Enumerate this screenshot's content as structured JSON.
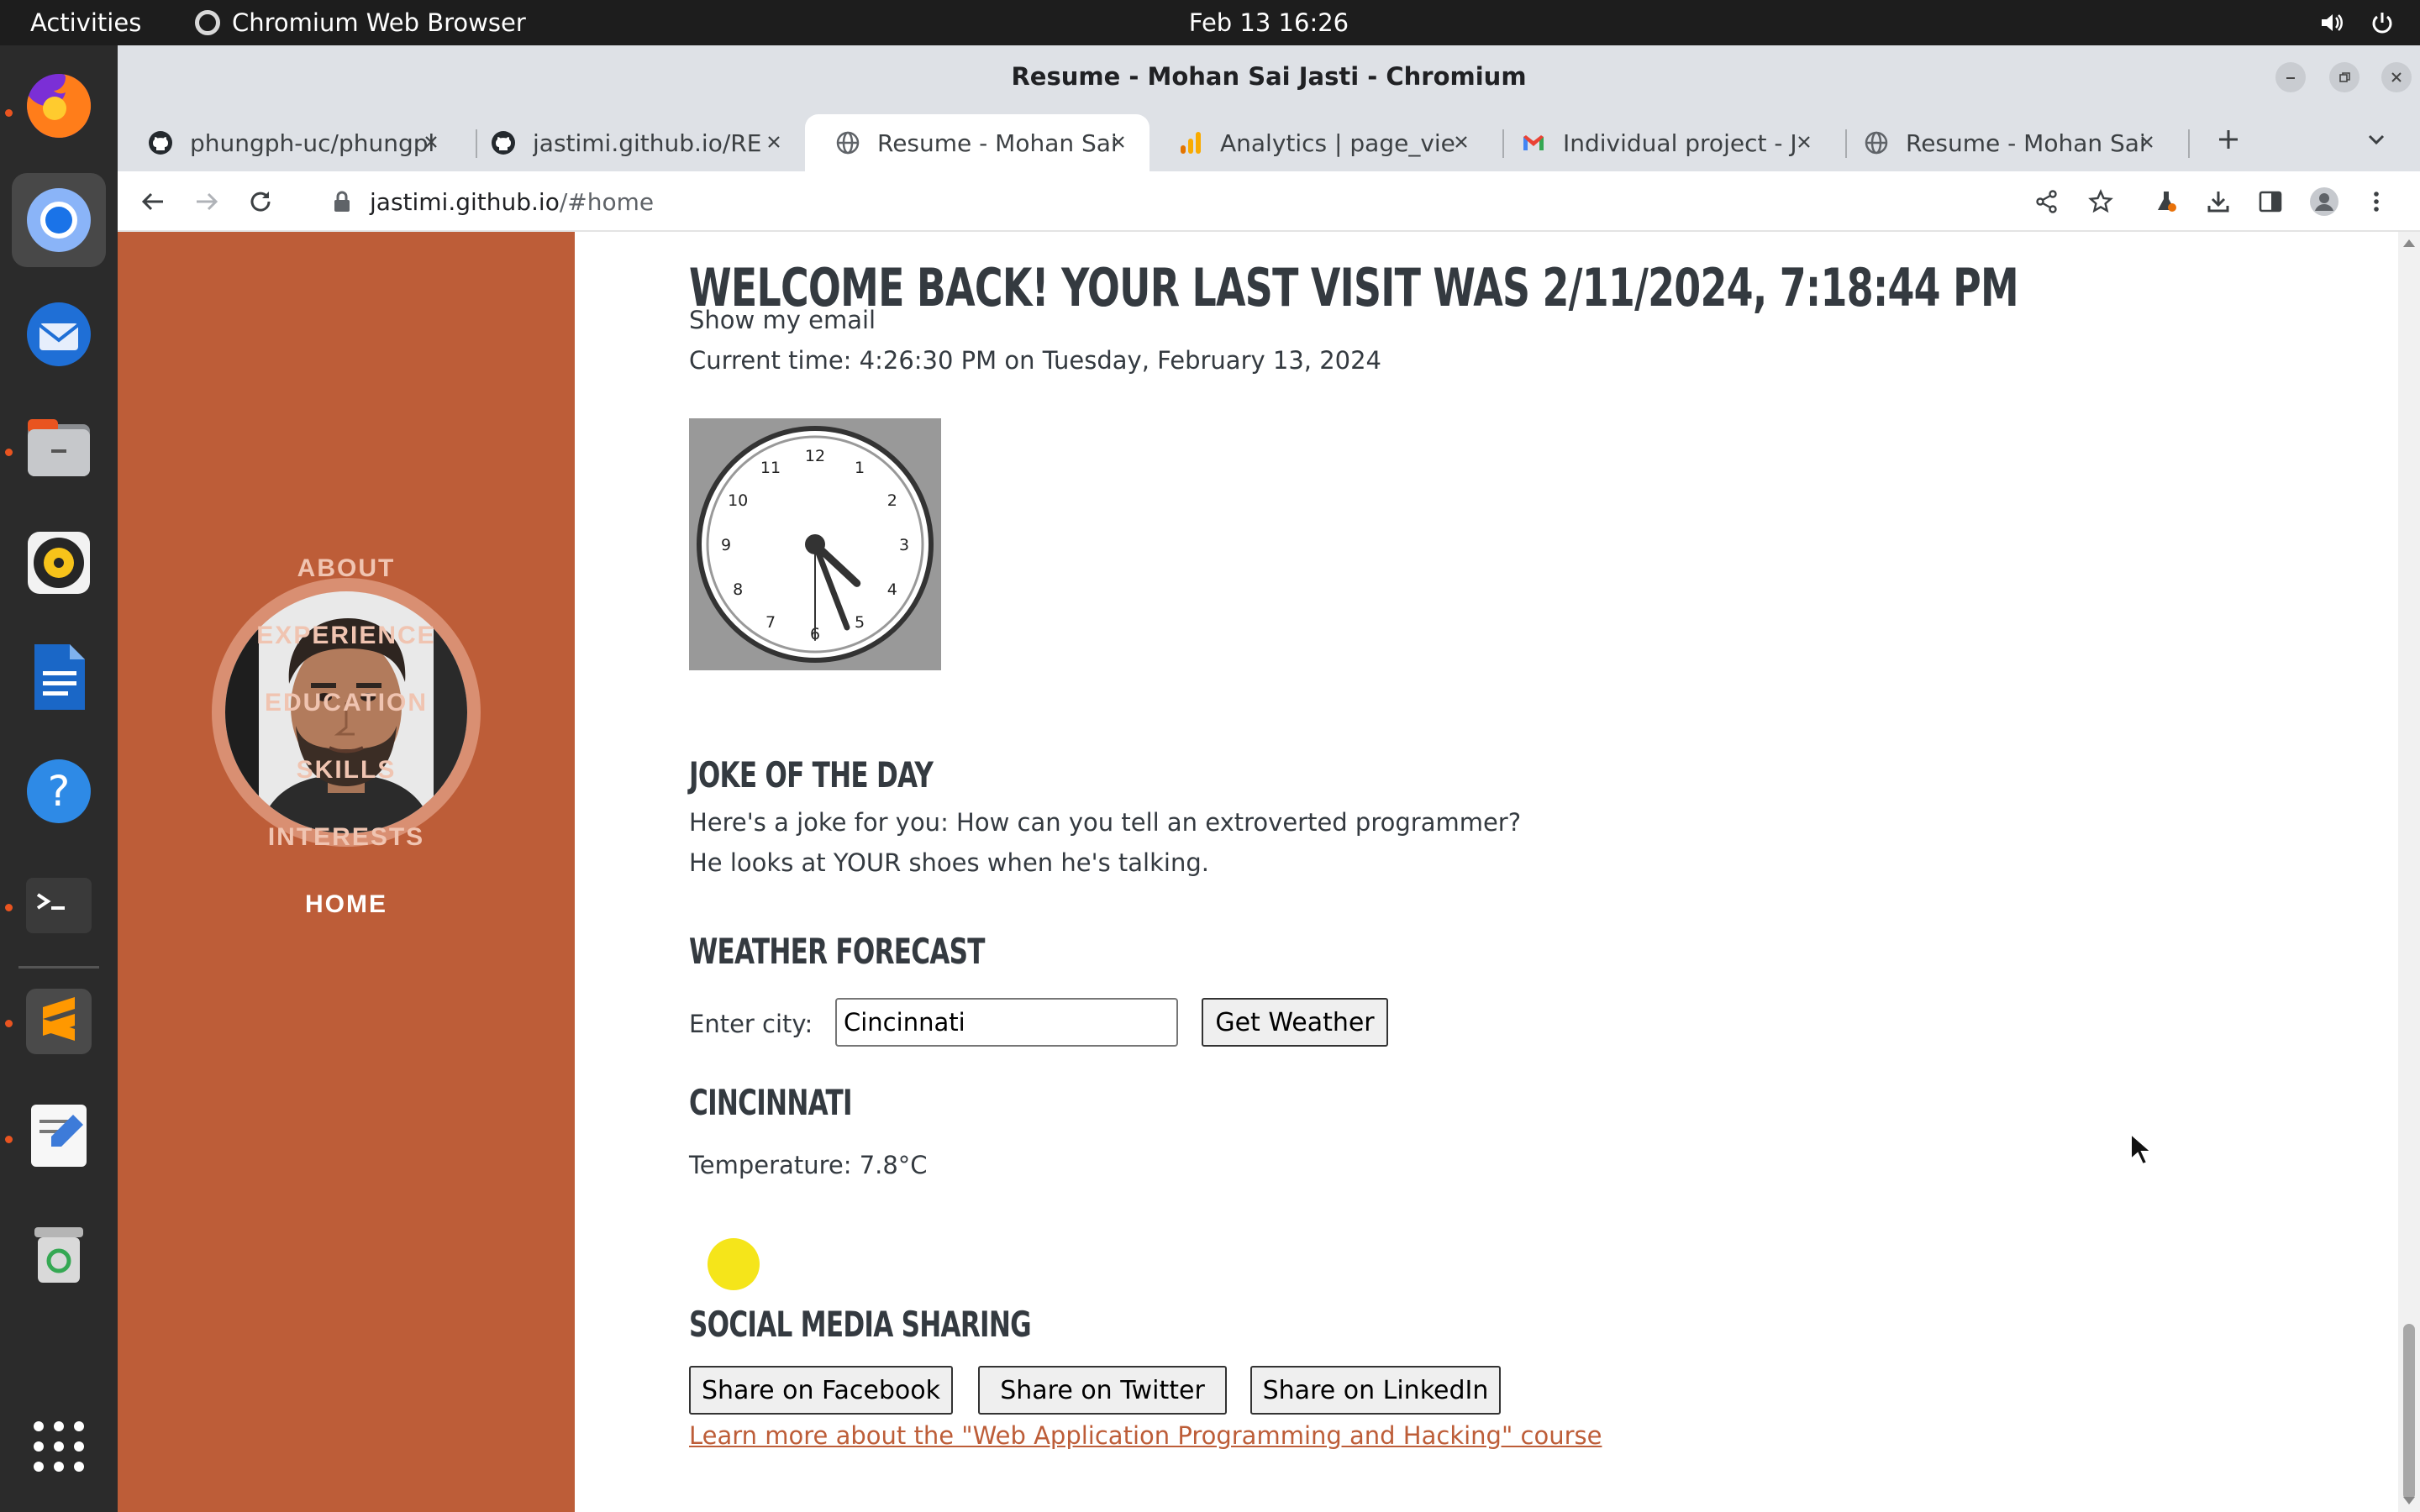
{
  "topbar": {
    "activities": "Activities",
    "app_name": "Chromium Web Browser",
    "datetime": "Feb 13  16:26"
  },
  "dock": {
    "items": [
      "firefox-icon",
      "chromium-icon",
      "thunderbird-icon",
      "files-icon",
      "rhythmbox-icon",
      "writer-icon",
      "help-icon",
      "terminal-icon",
      "sublime-icon",
      "text-editor-icon",
      "trash-icon",
      "app-grid-icon"
    ]
  },
  "window": {
    "title": "Resume - Mohan Sai Jasti - Chromium"
  },
  "tabs": [
    {
      "label": "phungph-uc/phungph",
      "icon": "github-icon"
    },
    {
      "label": "jastimi.github.io/RE",
      "icon": "github-icon"
    },
    {
      "label": "Resume - Mohan Sai",
      "icon": "globe-icon",
      "active": true
    },
    {
      "label": "Analytics | page_vie",
      "icon": "analytics-icon"
    },
    {
      "label": "Individual project - J",
      "icon": "gmail-icon"
    },
    {
      "label": "Resume - Mohan Sai",
      "icon": "globe-icon"
    }
  ],
  "toolbar": {
    "url_host": "jastimi.github.io",
    "url_path": "/#home"
  },
  "sidebar": {
    "nav": [
      "ABOUT",
      "EXPERIENCE",
      "EDUCATION",
      "SKILLS",
      "INTERESTS",
      "HOME"
    ],
    "current": "HOME"
  },
  "main": {
    "welcome": "WELCOME BACK! YOUR LAST VISIT WAS 2/11/2024, 7:18:44 PM",
    "show_email": "Show my email",
    "current_time": "Current time: 4:26:30 PM on Tuesday, February 13, 2024",
    "clock": {
      "hours": 4,
      "minutes": 26,
      "seconds": 30,
      "numbers": [
        "12",
        "1",
        "2",
        "3",
        "4",
        "5",
        "6",
        "7",
        "8",
        "9",
        "10",
        "11"
      ]
    },
    "joke_heading": "JOKE OF THE DAY",
    "joke_line1": "Here's a joke for you: How can you tell an extroverted programmer?",
    "joke_line2": "He looks at YOUR shoes when he's talking.",
    "weather_heading": "WEATHER FORECAST",
    "city_label": "Enter city:",
    "city_value": "Cincinnati",
    "get_weather": "Get Weather",
    "city_heading": "CINCINNATI",
    "temperature": "Temperature: 7.8°C",
    "social_heading": "SOCIAL MEDIA SHARING",
    "share_facebook": "Share on Facebook",
    "share_twitter": "Share on Twitter",
    "share_linkedin": "Share on LinkedIn",
    "course_link": "Learn more about the \"Web Application Programming and Hacking\" course"
  },
  "colors": {
    "sidebar": "#bd5d38",
    "heading": "#343a40",
    "link": "#bd5d38",
    "yellow_dot": "#f5e51a"
  }
}
